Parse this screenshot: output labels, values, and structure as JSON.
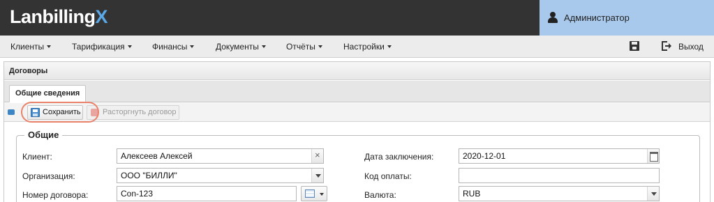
{
  "app": {
    "logo_main": "Lanbilling",
    "logo_accent": "X",
    "user_name": "Администратор"
  },
  "menu": {
    "items": [
      "Клиенты",
      "Тарификация",
      "Финансы",
      "Документы",
      "Отчёты",
      "Настройки"
    ],
    "logout_label": "Выход"
  },
  "panel": {
    "title": "Договоры",
    "tab_label": "Общие сведения",
    "toolbar": {
      "save_label": "Сохранить",
      "terminate_label": "Расторгнуть договор"
    }
  },
  "form": {
    "legend": "Общие",
    "client_label": "Клиент:",
    "client_value": "Алексеев Алексей",
    "org_label": "Организация:",
    "org_value": "ООО \"БИЛЛИ\"",
    "number_label": "Номер договора:",
    "number_value": "Con-123",
    "date_label": "Дата заключения:",
    "date_value": "2020-12-01",
    "paycode_label": "Код оплаты:",
    "paycode_value": "",
    "currency_label": "Валюта:",
    "currency_value": "RUB"
  },
  "colors": {
    "topbar": "#333333",
    "userbox": "#a9c9ec",
    "logo_accent": "#5aa8e6",
    "highlight": "#e9826a"
  }
}
